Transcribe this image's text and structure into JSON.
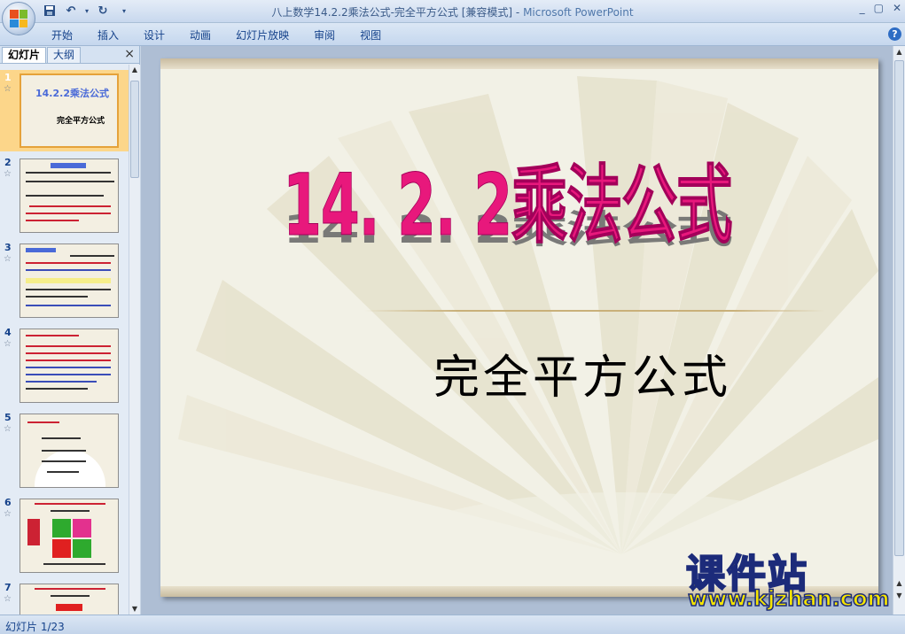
{
  "window": {
    "title": "八上数学14.2.2乘法公式-完全平方公式 [兼容模式]",
    "title_separator": " - ",
    "app_name": "Microsoft PowerPoint",
    "controls": [
      "_",
      "▢",
      "✕"
    ]
  },
  "quick_access": {
    "save_icon": "floppy-disk-icon",
    "undo_icon": "undo-icon",
    "redo_icon": "redo-icon"
  },
  "ribbon": {
    "tabs": [
      "开始",
      "插入",
      "设计",
      "动画",
      "幻灯片放映",
      "审阅",
      "视图"
    ],
    "help_label": "?"
  },
  "left_pane": {
    "tabs": [
      "幻灯片",
      "大纲"
    ],
    "active_tab": "幻灯片",
    "close_label": "×",
    "slides": [
      {
        "number": "1",
        "title": "14.2.2乘法公式",
        "subtitle": "完全平方公式"
      },
      {
        "number": "2"
      },
      {
        "number": "3"
      },
      {
        "number": "4"
      },
      {
        "number": "5"
      },
      {
        "number": "6"
      },
      {
        "number": "7"
      }
    ]
  },
  "slide": {
    "title": "14. 2. 2乘法公式",
    "subtitle": "完全平方公式"
  },
  "status": {
    "slide_indicator": "幻灯片 1/23"
  },
  "watermark": {
    "name": "课件站",
    "url": "www.kjzhan.com"
  },
  "colors": {
    "title_pink": "#e8187c",
    "ribbon_blue": "#15428b",
    "selected_thumb": "#fcd68a",
    "watermark_yellow": "#f5e400"
  }
}
